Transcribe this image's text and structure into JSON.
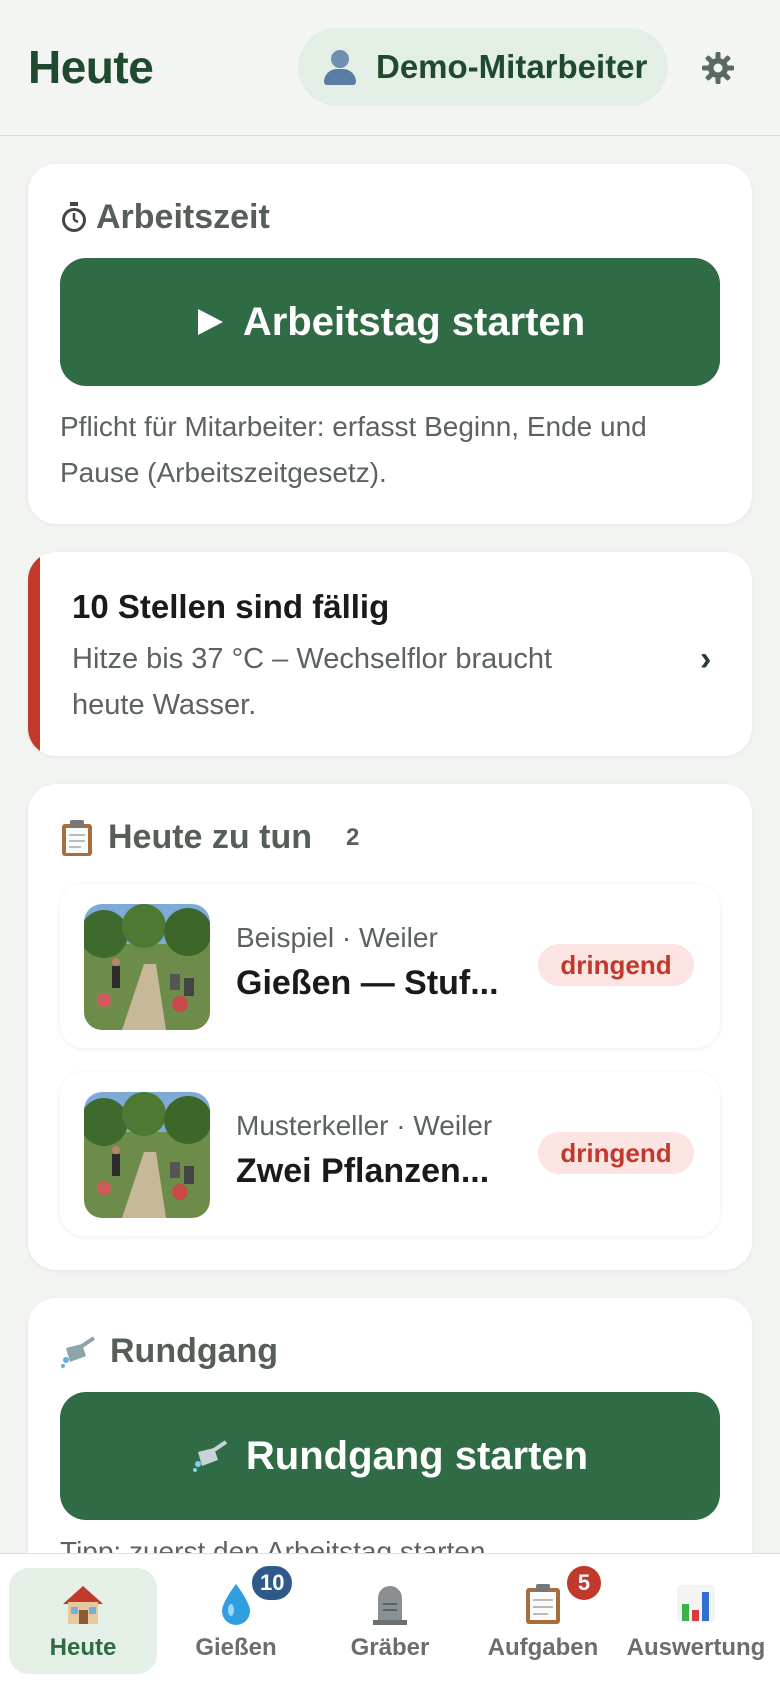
{
  "header": {
    "title": "Heute",
    "user_name": "Demo-Mitarbeiter",
    "user_icon": "user-icon",
    "settings_icon": "gear-icon"
  },
  "worktime": {
    "heading_icon": "stopwatch-icon",
    "heading": "Arbeitszeit",
    "button_label": "Arbeitstag starten",
    "button_icon": "play-icon",
    "note": "Pflicht für Mitarbeiter: erfasst Beginn, Ende und Pause (Arbeitszeitgesetz)."
  },
  "alert": {
    "title": "10 Stellen sind fällig",
    "text": "Hitze bis 37 °C – Wechselflor braucht heute Wasser.",
    "chevron": "›",
    "accent_color": "#c0392b"
  },
  "todo": {
    "heading_icon": "clipboard-icon",
    "heading": "Heute zu tun",
    "count": "2",
    "items": [
      {
        "subtitle": "Beispiel · Weiler",
        "title": "Gießen — Stuf...",
        "badge": "dringend",
        "thumb": "grave-garden-photo"
      },
      {
        "subtitle": "Musterkeller · Weiler",
        "title": "Zwei Pflanzen...",
        "badge": "dringend",
        "thumb": "grave-garden-photo"
      }
    ]
  },
  "tour": {
    "heading_icon": "watering-can-icon",
    "heading": "Rundgang",
    "button_label": "Rundgang starten",
    "button_icon": "watering-can-icon",
    "note": "Tipp: zuerst den Arbeitstag starten."
  },
  "bottom_nav": {
    "items": [
      {
        "label": "Heute",
        "icon": "house-icon",
        "active": true
      },
      {
        "label": "Gießen",
        "icon": "water-drop-icon",
        "badge": "10",
        "badge_color": "#2e5a8a"
      },
      {
        "label": "Gräber",
        "icon": "headstone-icon"
      },
      {
        "label": "Aufgaben",
        "icon": "clipboard-icon",
        "badge": "5",
        "badge_color": "#c0392b"
      },
      {
        "label": "Auswertung",
        "icon": "bar-chart-icon"
      }
    ]
  },
  "colors": {
    "primary": "#2f6b45",
    "danger": "#c0392b",
    "badge_blue": "#2e5a8a",
    "background": "#f2f4f1"
  }
}
